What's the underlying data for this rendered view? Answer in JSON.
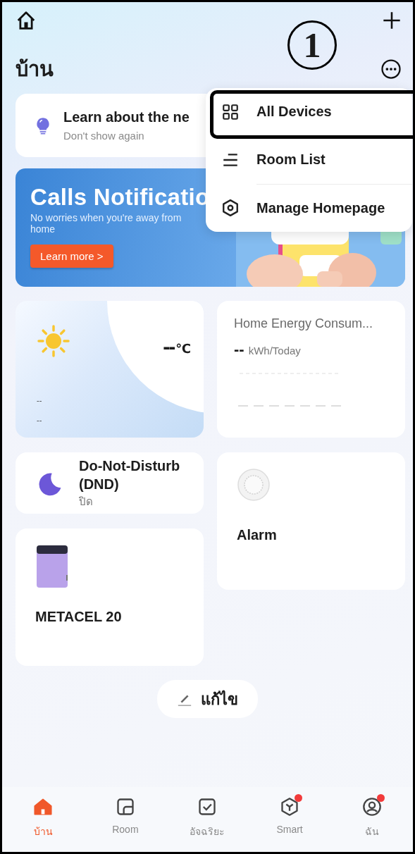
{
  "top_bar": {
    "title": "บ้าน",
    "callout": "1"
  },
  "tip_card": {
    "title": "Learn about the ne",
    "action": "Don't show again"
  },
  "banner": {
    "title": "Calls Notificatio",
    "subtitle": "No worries when you're away from home",
    "button": "Learn more >"
  },
  "menu": {
    "items": [
      {
        "label": "All Devices",
        "kind": "grid",
        "highlighted": true
      },
      {
        "label": "Room List",
        "kind": "list",
        "highlighted": false
      },
      {
        "label": "Manage Homepage",
        "kind": "hexagon",
        "highlighted": false
      }
    ]
  },
  "columns": [
    [
      {
        "kind": "weather",
        "temperature": "--",
        "unit": "℃",
        "lines": [
          "--",
          "--"
        ]
      },
      {
        "kind": "scene",
        "name": "Do-Not-Disturb (DND)",
        "status": "ปิด"
      },
      {
        "kind": "box-device",
        "name": "METACEL 20"
      }
    ],
    [
      {
        "kind": "energy",
        "title": "Home Energy Consum...",
        "value": "--",
        "unit": "kWh/Today"
      },
      {
        "kind": "round-device",
        "name": "Alarm"
      }
    ]
  ],
  "edit_button": {
    "label": "แก้ไข"
  },
  "tabs": [
    {
      "label": "บ้าน",
      "kind": "home",
      "selected": true,
      "badge": false
    },
    {
      "label": "Room",
      "kind": "room",
      "selected": false,
      "badge": false
    },
    {
      "label": "อัจฉริยะ",
      "kind": "check",
      "selected": false,
      "badge": false
    },
    {
      "label": "Smart",
      "kind": "cube",
      "selected": false,
      "badge": true
    },
    {
      "label": "ฉัน",
      "kind": "user",
      "selected": false,
      "badge": true
    }
  ]
}
